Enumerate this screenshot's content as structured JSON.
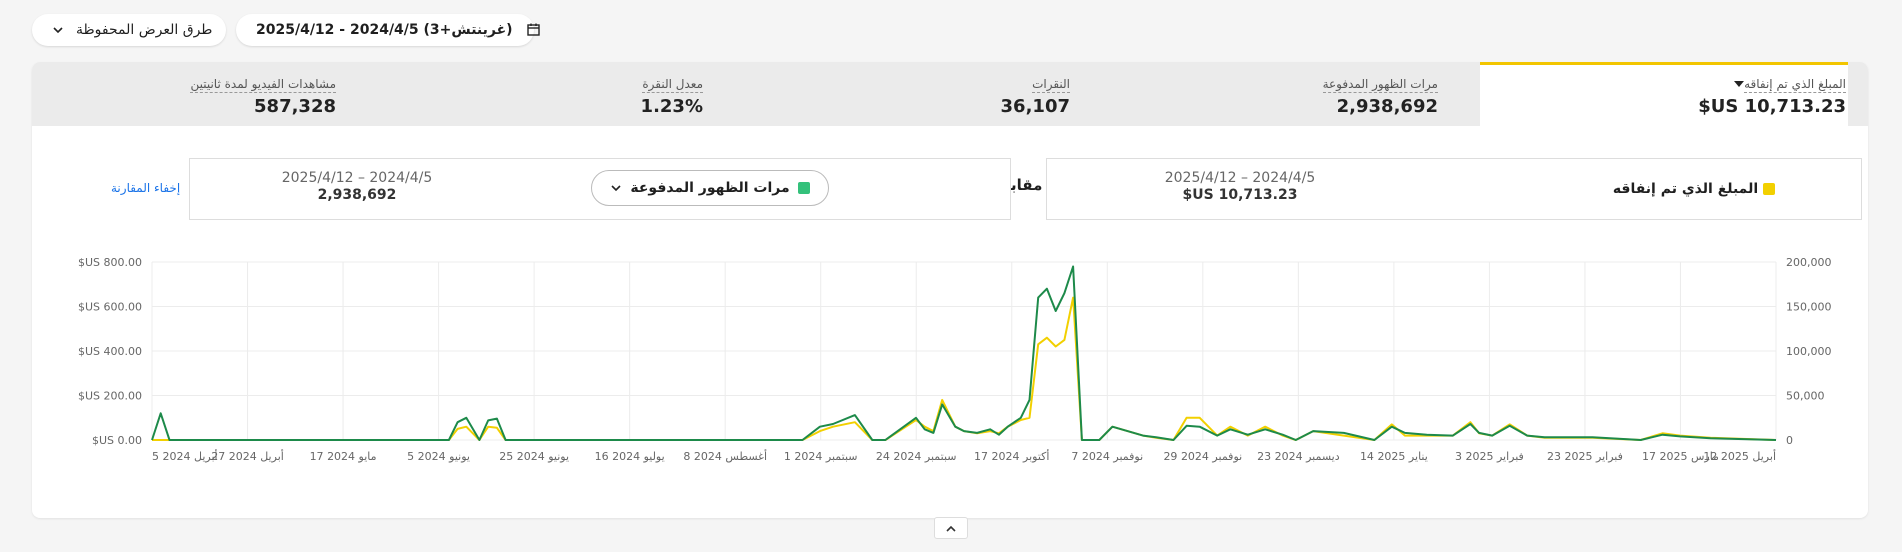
{
  "toolbar": {
    "saved_views_label": "طرق العرض المحفوظة",
    "date_range_label": "2025/4/12 - 2024/4/5 (غرينتش+3)"
  },
  "metrics": [
    {
      "label": "المبلغ الذي تم إنفاقه",
      "value": "$US 10,713.23"
    },
    {
      "label": "مرات الظهور المدفوعة",
      "value": "2,938,692"
    },
    {
      "label": "النقرات",
      "value": "36,107"
    },
    {
      "label": "معدل النقرة",
      "value": "1.23%"
    },
    {
      "label": "مشاهدات الفيديو لمدة ثانيتين",
      "value": "587,328"
    }
  ],
  "comparison": {
    "primary": {
      "name": "المبلغ الذي تم إنفاقه",
      "range": "2025/4/12 – 2024/4/5",
      "value": "$US 10,713.23",
      "color": "#f2d000"
    },
    "vs_label": "مقابل",
    "secondary": {
      "name": "مرات الظهور المدفوعة",
      "range": "2025/4/12 – 2024/4/5",
      "value": "2,938,692",
      "color": "#34c17b"
    },
    "hide_label": "إخفاء المقارنة"
  },
  "chart_data": {
    "type": "line",
    "x_ticks": [
      "5 أبريل 2024",
      "27 أبريل 2024",
      "17 مايو 2024",
      "5 يونيو 2024",
      "25 يونيو 2024",
      "16 يوليو 2024",
      "8 أغسطس 2024",
      "1 سبتمبر 2024",
      "24 سبتمبر 2024",
      "17 أكتوبر 2024",
      "7 نوفمبر 2024",
      "29 نوفمبر 2024",
      "23 ديسمبر 2024",
      "14 يناير 2025",
      "3 فبراير 2025",
      "23 فبراير 2025",
      "17 مارس 2025",
      "12 أبريل 2025"
    ],
    "y_left_ticks": [
      "$US 800.00",
      "$US 600.00",
      "$US 400.00",
      "$US 200.00",
      "$US 0.00"
    ],
    "y_left_range": [
      0,
      800
    ],
    "y_right_ticks": [
      "200,000",
      "150,000",
      "100,000",
      "50,000",
      "0"
    ],
    "y_right_range": [
      0,
      200000
    ],
    "series": [
      {
        "name": "المبلغ الذي تم إنفاقه",
        "axis": "left",
        "color": "#f2d000",
        "x": [
          "2024-04-05",
          "2024-04-07",
          "2024-04-09",
          "2024-04-12",
          "2024-06-12",
          "2024-06-14",
          "2024-06-16",
          "2024-06-19",
          "2024-06-21",
          "2024-06-23",
          "2024-06-25",
          "2024-09-01",
          "2024-09-05",
          "2024-09-08",
          "2024-09-13",
          "2024-09-17",
          "2024-09-20",
          "2024-09-27",
          "2024-09-29",
          "2024-10-01",
          "2024-10-03",
          "2024-10-06",
          "2024-10-08",
          "2024-10-11",
          "2024-10-14",
          "2024-10-16",
          "2024-10-18",
          "2024-10-21",
          "2024-10-23",
          "2024-10-25",
          "2024-10-27",
          "2024-10-29",
          "2024-10-31",
          "2024-11-02",
          "2024-11-04",
          "2024-11-08",
          "2024-11-11",
          "2024-11-18",
          "2024-11-21",
          "2024-11-25",
          "2024-11-28",
          "2024-12-01",
          "2024-12-05",
          "2024-12-08",
          "2024-12-12",
          "2024-12-16",
          "2024-12-20",
          "2024-12-23",
          "2024-12-27",
          "2025-01-03",
          "2025-01-10",
          "2025-01-14",
          "2025-01-17",
          "2025-01-22",
          "2025-01-28",
          "2025-02-01",
          "2025-02-03",
          "2025-02-06",
          "2025-02-10",
          "2025-02-14",
          "2025-02-18",
          "2025-03-01",
          "2025-03-12",
          "2025-03-17",
          "2025-03-21",
          "2025-03-28",
          "2025-04-12"
        ],
        "values": [
          0,
          0,
          0,
          0,
          0,
          50,
          60,
          0,
          60,
          55,
          0,
          0,
          40,
          60,
          80,
          0,
          0,
          90,
          60,
          40,
          180,
          60,
          40,
          30,
          40,
          30,
          60,
          90,
          100,
          430,
          460,
          420,
          450,
          640,
          0,
          0,
          60,
          20,
          10,
          0,
          100,
          100,
          20,
          60,
          20,
          60,
          20,
          0,
          40,
          20,
          0,
          70,
          20,
          20,
          20,
          80,
          30,
          20,
          70,
          20,
          10,
          10,
          0,
          30,
          20,
          10,
          0
        ]
      },
      {
        "name": "مرات الظهور المدفوعة",
        "axis": "right",
        "color": "#1d8a4a",
        "x": [
          "2024-04-05",
          "2024-04-07",
          "2024-04-09",
          "2024-04-12",
          "2024-06-12",
          "2024-06-14",
          "2024-06-16",
          "2024-06-19",
          "2024-06-21",
          "2024-06-23",
          "2024-06-25",
          "2024-09-01",
          "2024-09-05",
          "2024-09-08",
          "2024-09-13",
          "2024-09-17",
          "2024-09-20",
          "2024-09-27",
          "2024-09-29",
          "2024-10-01",
          "2024-10-03",
          "2024-10-06",
          "2024-10-08",
          "2024-10-11",
          "2024-10-14",
          "2024-10-16",
          "2024-10-18",
          "2024-10-21",
          "2024-10-23",
          "2024-10-25",
          "2024-10-27",
          "2024-10-29",
          "2024-10-31",
          "2024-11-02",
          "2024-11-04",
          "2024-11-08",
          "2024-11-11",
          "2024-11-18",
          "2024-11-21",
          "2024-11-25",
          "2024-11-28",
          "2024-12-01",
          "2024-12-05",
          "2024-12-08",
          "2024-12-12",
          "2024-12-16",
          "2024-12-20",
          "2024-12-23",
          "2024-12-27",
          "2025-01-03",
          "2025-01-10",
          "2025-01-14",
          "2025-01-17",
          "2025-01-22",
          "2025-01-28",
          "2025-02-01",
          "2025-02-03",
          "2025-02-06",
          "2025-02-10",
          "2025-02-14",
          "2025-02-18",
          "2025-03-01",
          "2025-03-12",
          "2025-03-17",
          "2025-03-21",
          "2025-03-28",
          "2025-04-12"
        ],
        "values": [
          0,
          30000,
          0,
          0,
          0,
          20000,
          25000,
          0,
          22000,
          24000,
          0,
          0,
          15000,
          18000,
          28000,
          0,
          0,
          25000,
          12000,
          8000,
          40000,
          15000,
          10000,
          8000,
          12000,
          6000,
          15000,
          25000,
          45000,
          160000,
          170000,
          145000,
          165000,
          195000,
          0,
          0,
          15000,
          5000,
          3000,
          0,
          16000,
          15000,
          5000,
          12000,
          6000,
          12000,
          6000,
          0,
          10000,
          8000,
          0,
          15000,
          8000,
          6000,
          5000,
          18000,
          8000,
          5000,
          16000,
          5000,
          3000,
          3000,
          0,
          6000,
          4000,
          2000,
          0
        ]
      }
    ]
  }
}
